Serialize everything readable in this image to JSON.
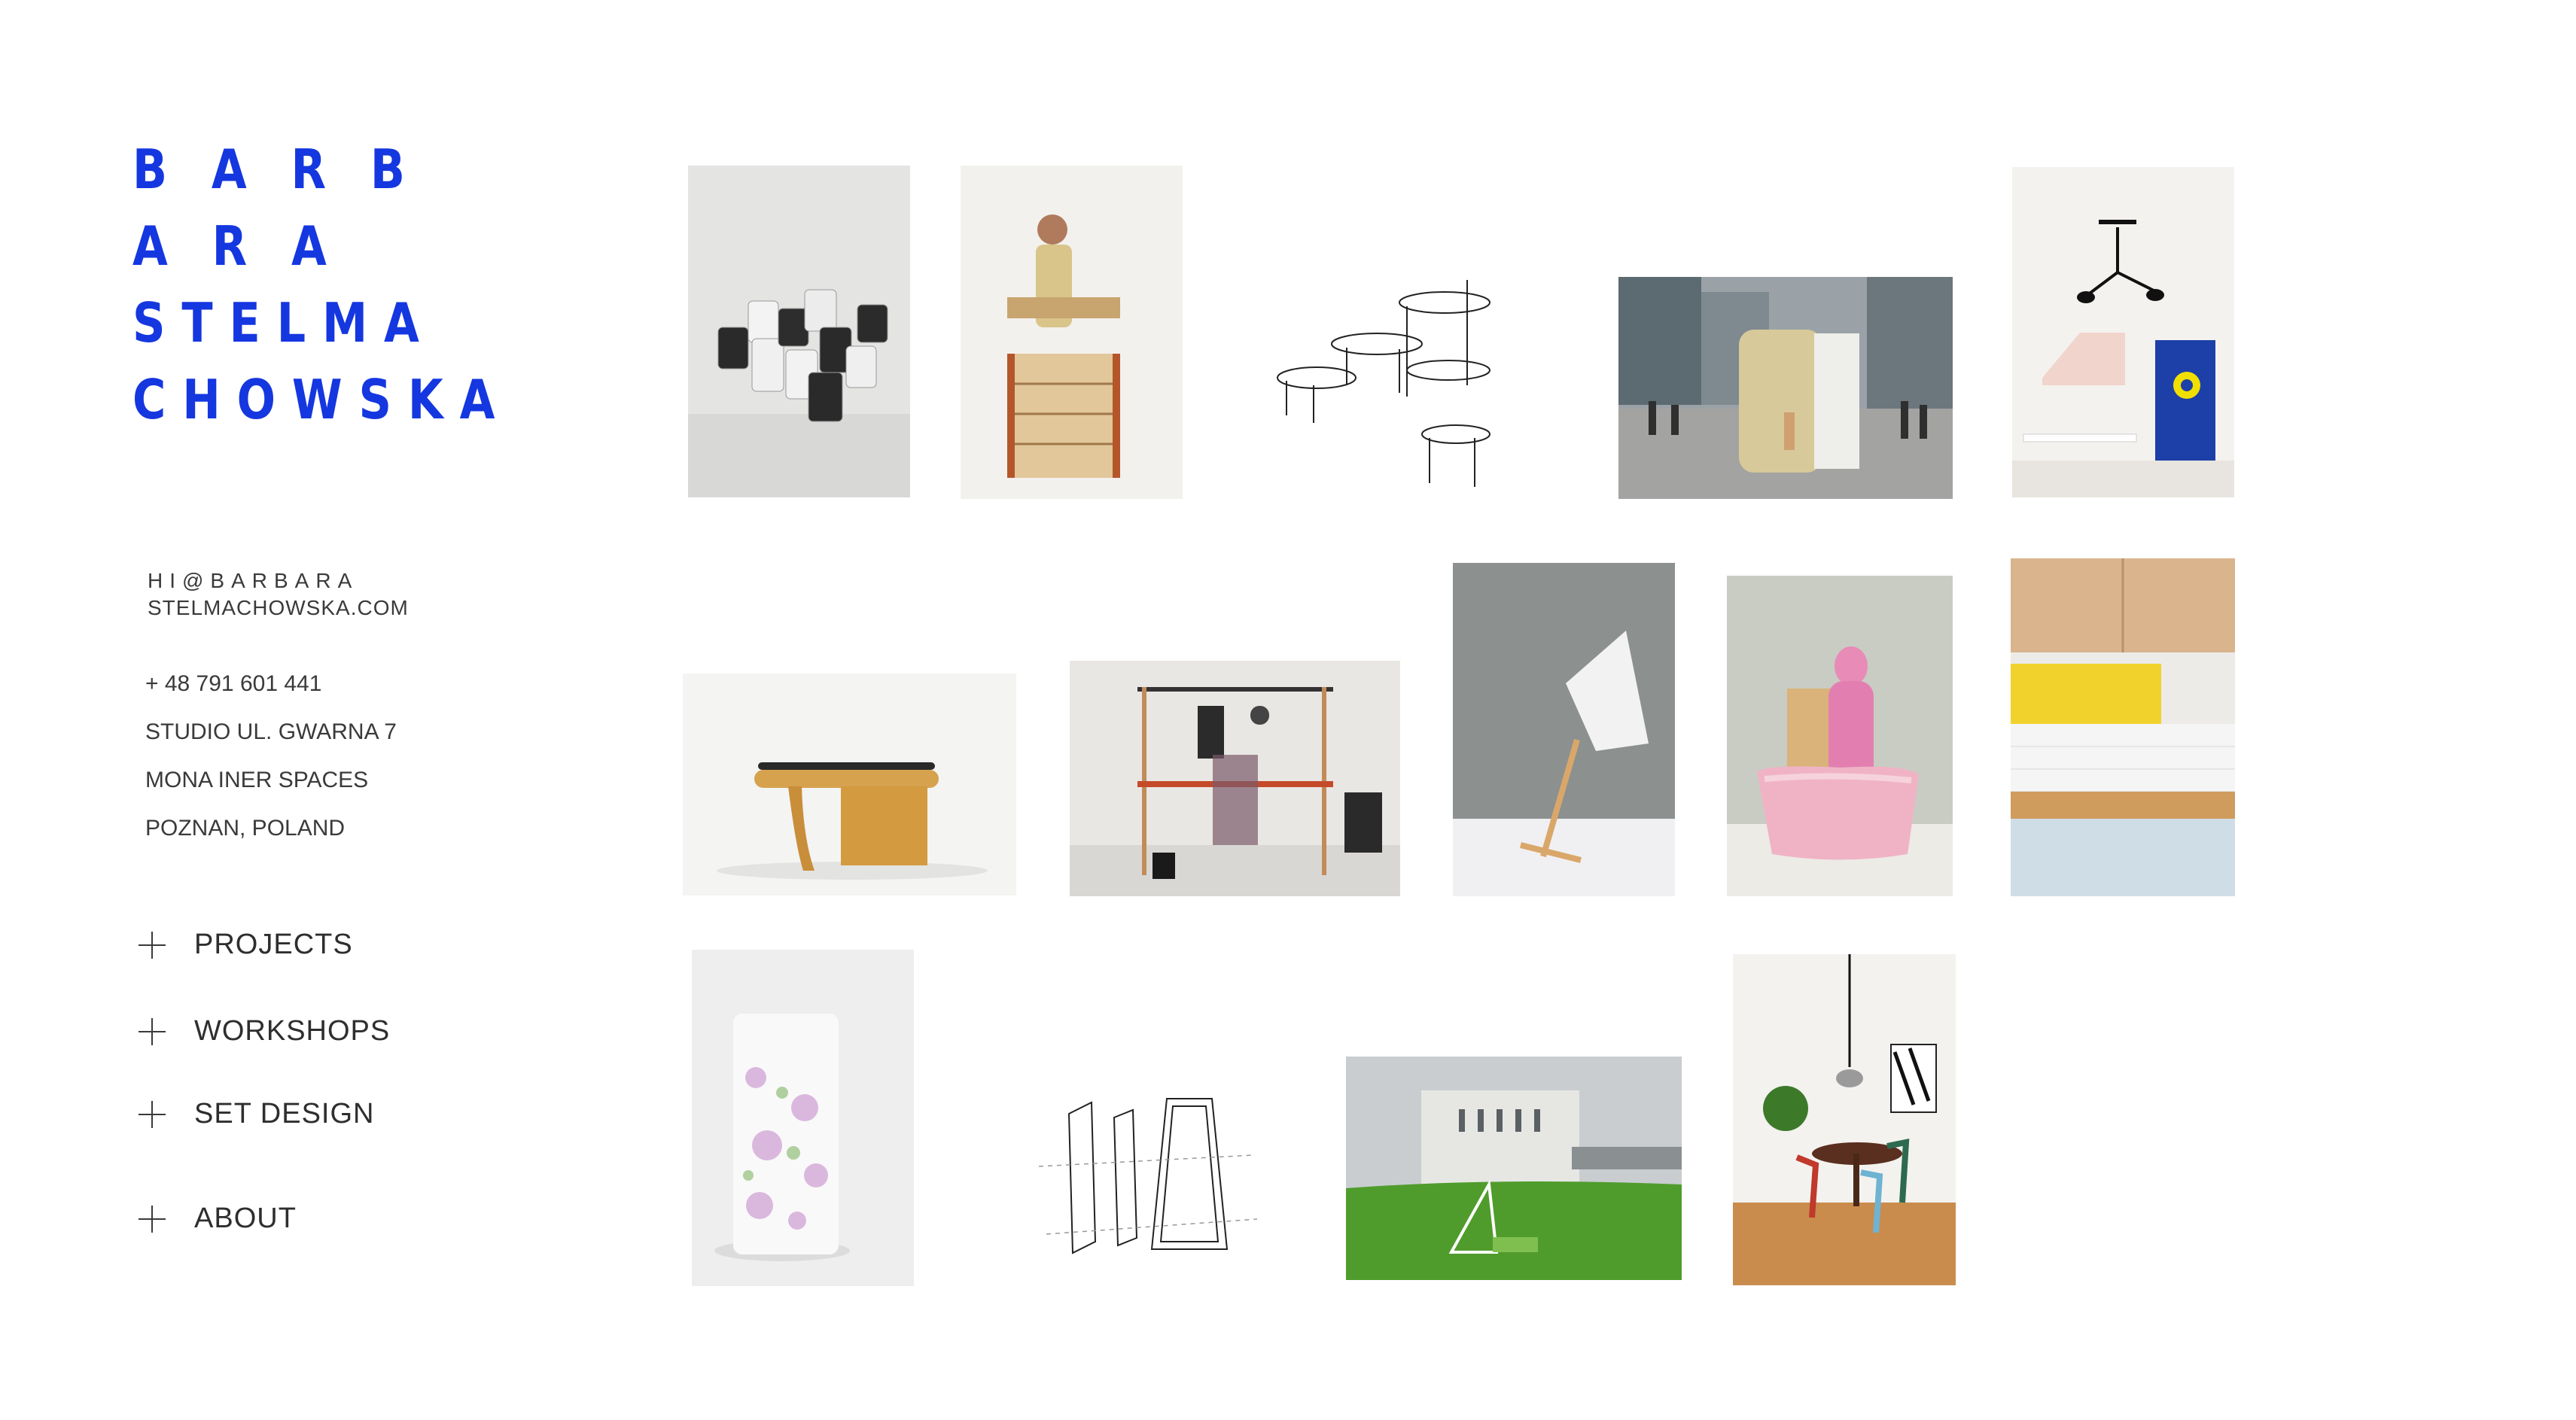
{
  "logo": {
    "lines": [
      "BARB",
      "ARA",
      "STELMA",
      "CHOWSKA"
    ]
  },
  "contact": {
    "email_line1": "HI@BARBARA",
    "email_line2": "STELMACHOWSKA.COM",
    "phone": "+ 48 791 601 441",
    "address_1": "STUDIO UL. GWARNA 7",
    "address_2": "MONA INER SPACES",
    "address_3": "POZNAN, POLAND"
  },
  "nav": {
    "projects": "PROJECTS",
    "workshops": "WORKSHOPS",
    "set_design": "SET DESIGN",
    "about": "ABOUT"
  },
  "colors": {
    "brand_blue": "#1537e0",
    "text": "#3a3a3a"
  },
  "icons": {
    "nav": "plus-icon"
  }
}
